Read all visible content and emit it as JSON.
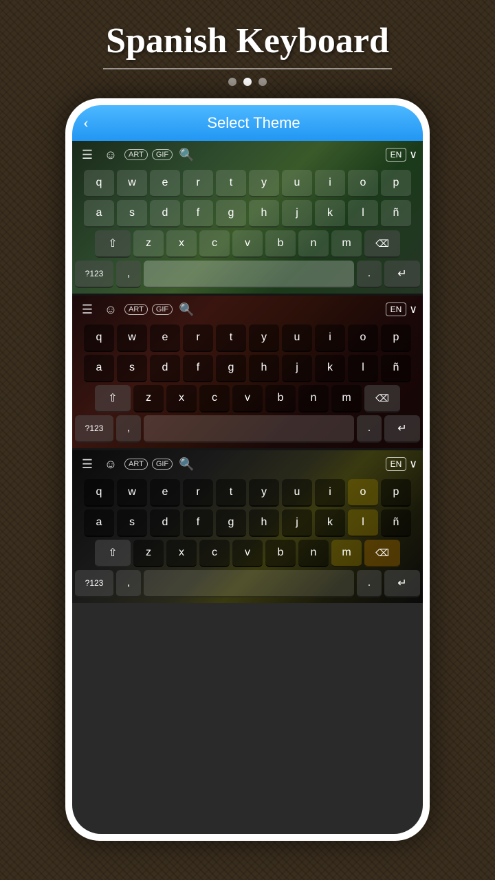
{
  "app": {
    "title": "Spanish Keyboard",
    "header_title": "Select Theme"
  },
  "dots": [
    {
      "active": false
    },
    {
      "active": true
    },
    {
      "active": false
    }
  ],
  "back_button_label": "‹",
  "keyboard_rows": {
    "row1": [
      "q",
      "w",
      "e",
      "r",
      "t",
      "y",
      "u",
      "i",
      "o",
      "p"
    ],
    "row2": [
      "a",
      "s",
      "d",
      "f",
      "g",
      "h",
      "j",
      "k",
      "l",
      "ñ"
    ],
    "row3": [
      "z",
      "x",
      "c",
      "v",
      "b",
      "n",
      "m"
    ],
    "special": {
      "shift": "⇧",
      "backspace": "⌫",
      "num": "?123",
      "comma": ",",
      "period": ".",
      "enter": "↵"
    }
  },
  "toolbar": {
    "menu_icon": "☰",
    "emoji_icon": "☺",
    "art_label": "ART",
    "gif_label": "GIF",
    "search_icon": "🔍",
    "lang_label": "EN",
    "chevron": "⌄"
  },
  "themes": [
    {
      "name": "green-forest",
      "class": "theme-green"
    },
    {
      "name": "dark-fire",
      "class": "theme-dark-fire"
    },
    {
      "name": "dark-gold",
      "class": "theme-dark-gold"
    }
  ]
}
